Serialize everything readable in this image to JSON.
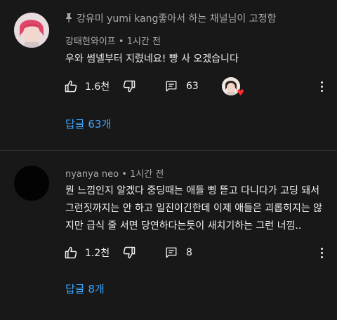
{
  "comments": [
    {
      "pinned_text": "강유미 yumi kang좋아서 하는 채널님이 고정함",
      "author": "강태현와이프",
      "time": "1시간 전",
      "text": "우와 썸넬부터 지렸네요! 빵 사 오겠습니다",
      "likes": "1.6천",
      "reply_count": "63",
      "creator_heart": true,
      "view_replies": "답글 63개"
    },
    {
      "author": "nyanya neo",
      "time": "1시간 전",
      "text": "뭔 느낌인지 알겠다 중딩때는 애들 삥 뜯고 다니다가 고딩 돼서 그런짓까지는 안 하고 일진이긴한데 이제 애들은 괴롭히지는 않지만 급식 줄 서면 당연하다는듯이 새치기하는 그런 너낌..",
      "likes": "1.2천",
      "reply_count": "8",
      "view_replies": "답글 8개"
    }
  ],
  "meta_separator": " • ",
  "icons": {
    "like": "thumbs-up-icon",
    "dislike": "thumbs-down-icon",
    "reply": "comment-icon",
    "more": "more-vertical-icon",
    "pin": "pin-icon",
    "heart": "heart-icon"
  },
  "colors": {
    "background": "#181818",
    "text": "#f1f1f1",
    "secondary_text": "#aaaaaa",
    "link": "#3ea6ff",
    "heart": "#ff2d2d"
  }
}
